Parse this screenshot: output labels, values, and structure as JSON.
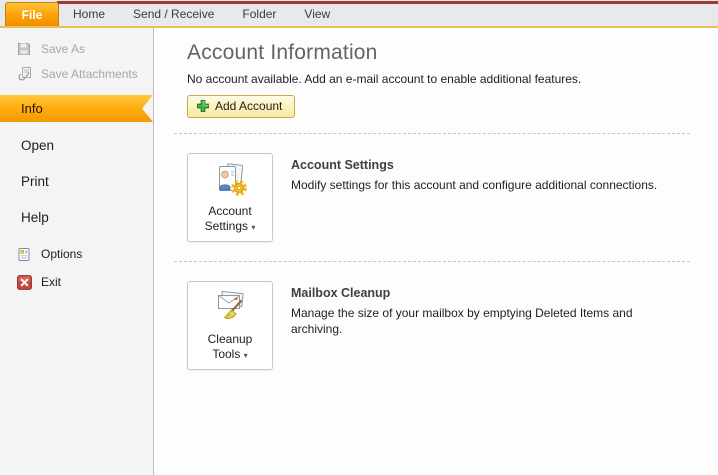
{
  "ribbon": {
    "tabs": [
      {
        "label": "File",
        "active": true
      },
      {
        "label": "Home"
      },
      {
        "label": "Send / Receive"
      },
      {
        "label": "Folder"
      },
      {
        "label": "View"
      }
    ]
  },
  "sidebar": {
    "disabled_items": [
      {
        "label": "Save As",
        "icon": "save-as-icon"
      },
      {
        "label": "Save Attachments",
        "icon": "save-attachments-icon"
      }
    ],
    "selected_item": {
      "label": "Info"
    },
    "nav_items": [
      {
        "label": "Open"
      },
      {
        "label": "Print"
      },
      {
        "label": "Help"
      }
    ],
    "footer_items": [
      {
        "label": "Options",
        "icon": "options-icon"
      },
      {
        "label": "Exit",
        "icon": "exit-icon"
      }
    ]
  },
  "main": {
    "title": "Account Information",
    "subtitle": "No account available. Add an e-mail account to enable additional features.",
    "add_account_label": "Add Account",
    "sections": [
      {
        "button_label": "Account Settings",
        "heading": "Account Settings",
        "description_lines": [
          "Modify settings for this account and configure additional connections."
        ],
        "icon": "account-settings-icon"
      },
      {
        "button_label": "Cleanup Tools",
        "heading": "Mailbox Cleanup",
        "description_lines": [
          "Manage the size of your mailbox by emptying Deleted Items and",
          "archiving."
        ],
        "icon": "cleanup-tools-icon"
      }
    ]
  },
  "ui": {
    "dropdown_arrow": "▾"
  },
  "colors": {
    "accent_red": "#9c3a37",
    "tab_gold_line": "#eec04f",
    "file_tab_orange_light": "#ffc139",
    "info_orange_top": "#ffc83d",
    "info_orange_bottom": "#f39a00",
    "add_button_border": "#c9aa4d",
    "plus_green": "#47b545",
    "exit_red": "#c8473c",
    "sidebar_bg": "#f4f4f4",
    "content_bg": "#fdfdfe"
  }
}
